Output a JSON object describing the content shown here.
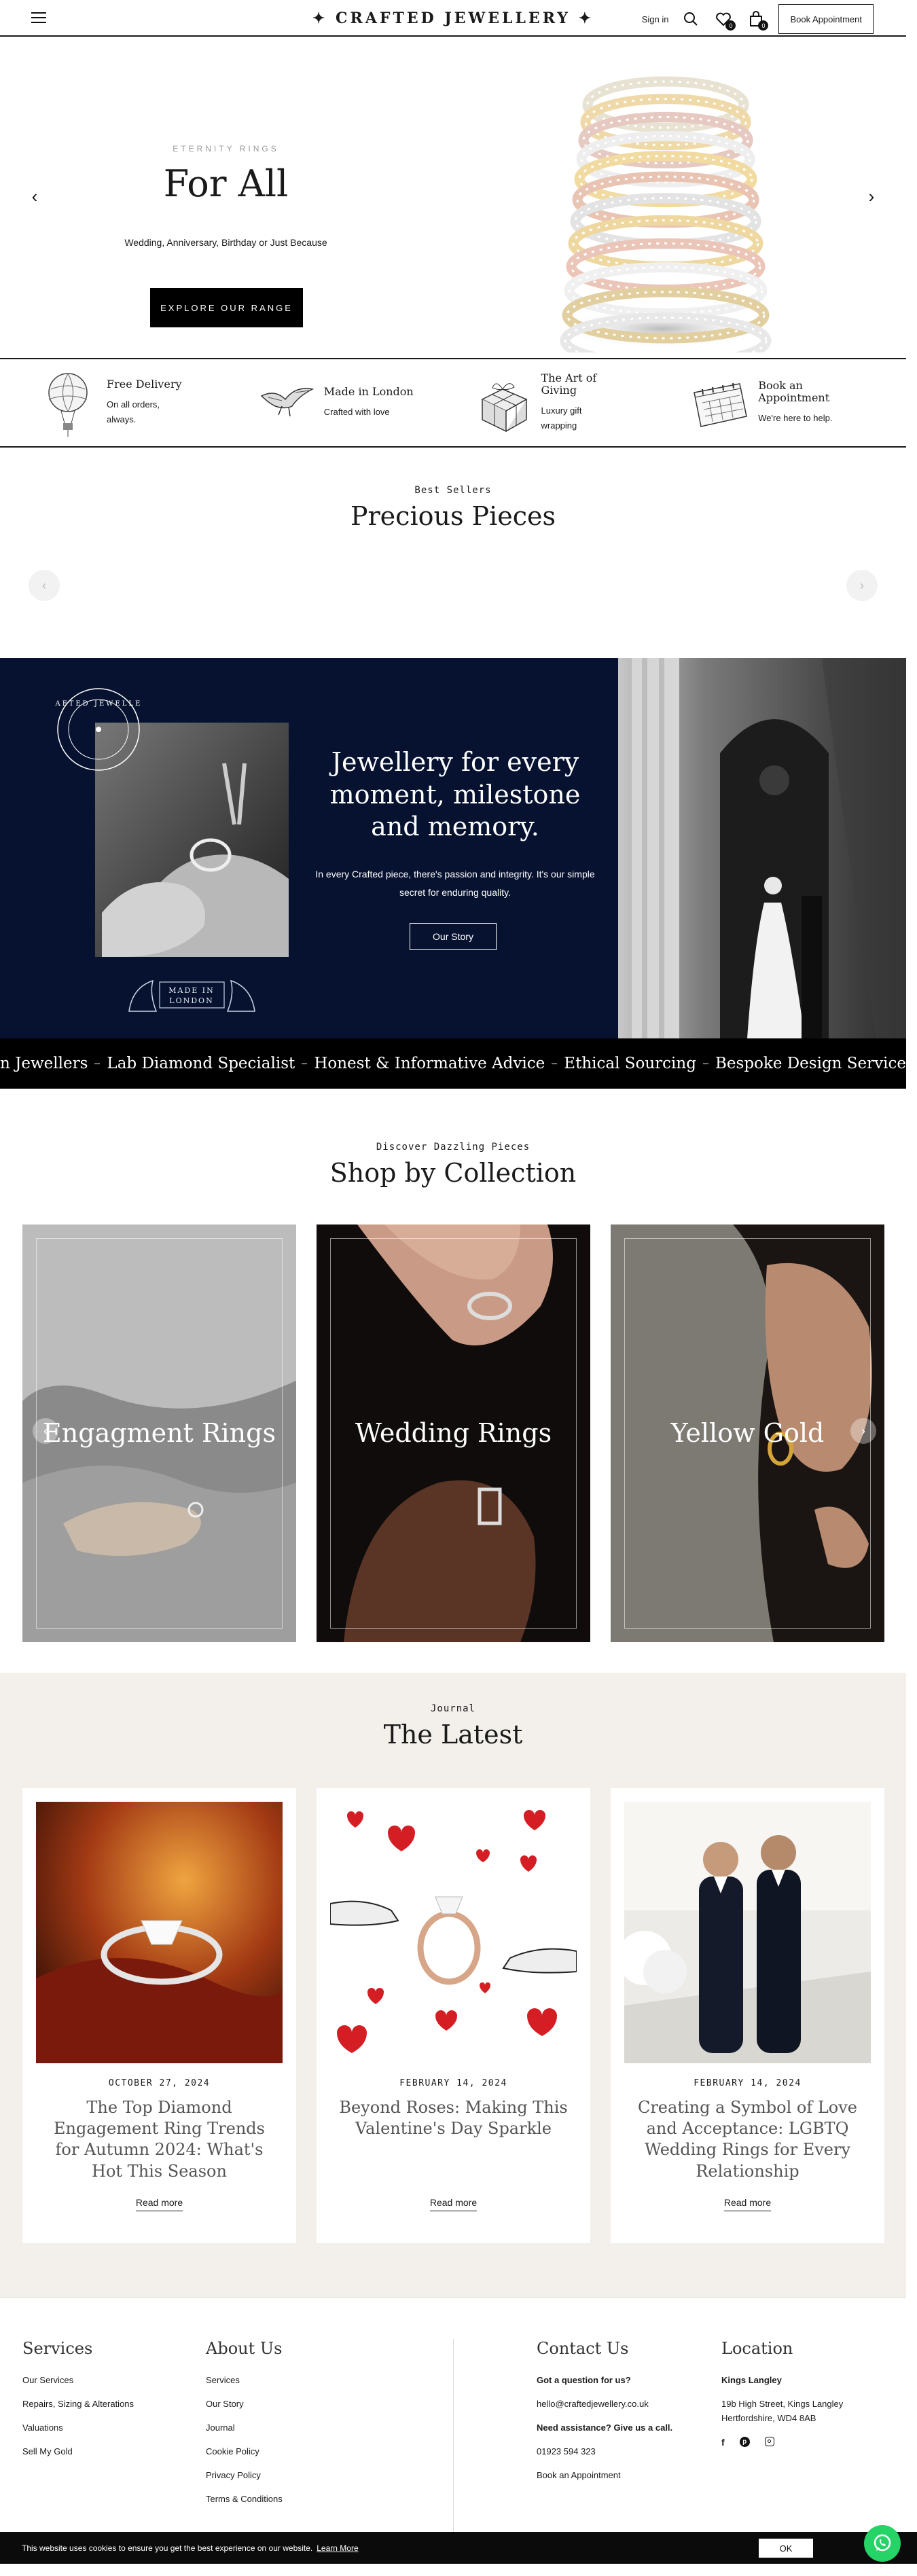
{
  "header": {
    "logo": "✦ CRAFTED JEWELLERY ✦",
    "sign_in": "Sign in",
    "wishlist_count": "0",
    "cart_count": "0",
    "book_button": "Book Appointment"
  },
  "hero": {
    "eyebrow": "ETERNITY RINGS",
    "title": "For All",
    "subtitle": "Wedding, Anniversary, Birthday or Just Because",
    "button": "EXPLORE OUR RANGE"
  },
  "usps": [
    {
      "title": "Free Delivery",
      "text": "On all orders, always.",
      "icon": "balloon-icon"
    },
    {
      "title": "Made in London",
      "text": "Crafted with love",
      "icon": "bird-icon"
    },
    {
      "title": "The Art of Giving",
      "text": "Luxury gift wrapping",
      "icon": "gift-icon"
    },
    {
      "title": "Book an Appointment",
      "text": "We're here to help.",
      "icon": "calendar-icon"
    }
  ],
  "best_sellers": {
    "eyebrow": "Best Sellers",
    "title": "Precious Pieces"
  },
  "story": {
    "stamp_text": "CRAFTED JEWELLERS",
    "made_in": "MADE IN LONDON",
    "title": "Jewellery for every moment, milestone and memory.",
    "text": "In every Crafted piece, there's passion and integrity. It's our simple secret for enduring quality.",
    "button": "Our Story"
  },
  "marquee": [
    "n Jewellers",
    "Lab Diamond Specialist",
    "Honest & Informative Advice",
    "Ethical Sourcing",
    "Bespoke Design Service"
  ],
  "collection": {
    "eyebrow": "Discover Dazzling Pieces",
    "title": "Shop by Collection",
    "cards": [
      "Engagment Rings",
      "Wedding Rings",
      "Yellow Gold"
    ]
  },
  "journal": {
    "eyebrow": "Journal",
    "title": "The Latest",
    "posts": [
      {
        "date": "OCTOBER 27, 2024",
        "title": "The Top Diamond Engagement Ring Trends for Autumn 2024: What's Hot This Season",
        "read": "Read more"
      },
      {
        "date": "FEBRUARY 14, 2024",
        "title": "Beyond Roses: Making This Valentine's Day Sparkle",
        "read": "Read more"
      },
      {
        "date": "FEBRUARY 14, 2024",
        "title": "Creating a Symbol of Love and Acceptance: LGBTQ Wedding Rings for Every Relationship",
        "read": "Read more"
      }
    ]
  },
  "footer": {
    "services_head": "Services",
    "services": [
      "Our Services",
      "Repairs, Sizing & Alterations",
      "Valuations",
      "Sell My Gold"
    ],
    "about_head": "About Us",
    "about": [
      "Services",
      "Our Story",
      "Journal",
      "Cookie Policy",
      "Privacy Policy",
      "Terms & Conditions"
    ],
    "contact_head": "Contact Us",
    "contact_q": "Got a question for us?",
    "contact_email": "hello@craftedjewellery.co.uk",
    "contact_call": "Need assistance? Give us a call.",
    "contact_phone": "01923 594 323",
    "contact_book": "Book an Appointment",
    "location_head": "Location",
    "location_name": "Kings Langley",
    "location_addr1": "19b High Street, Kings Langley",
    "location_addr2": "Hertfordshire, WD4 8AB"
  },
  "cookie": {
    "text": "This website uses cookies to ensure you get the best experience on our website.",
    "link": "Learn More",
    "ok": "OK"
  }
}
